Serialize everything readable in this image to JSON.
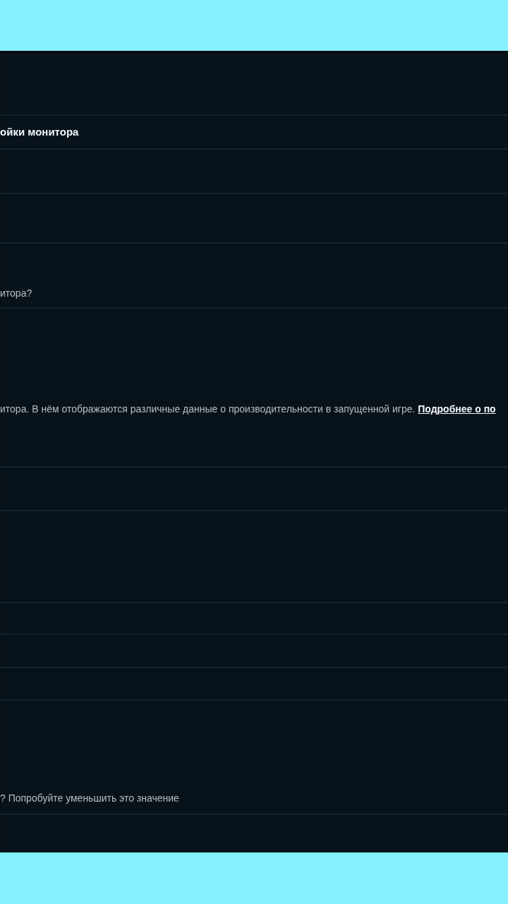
{
  "section": {
    "title": "ойки монитора"
  },
  "descriptions": [
    {
      "text": "итора?"
    },
    {
      "text": "итора. В нём отображаются различные данные о производительности в запущенной игре.",
      "link": "Подробнее о по"
    },
    {
      "text": "? Попробуйте уменьшить это значение"
    }
  ]
}
